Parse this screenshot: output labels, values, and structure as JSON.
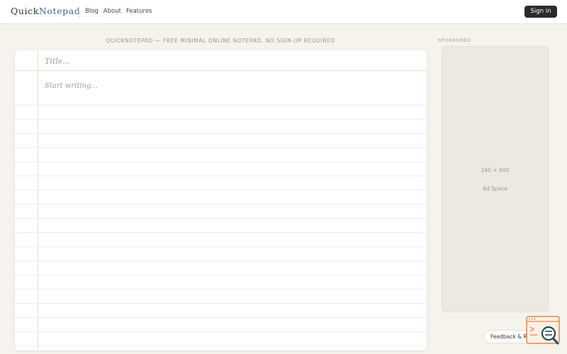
{
  "header": {
    "logo_part1": "Quick",
    "logo_part2": "Notepad",
    "nav": [
      {
        "label": "Blog"
      },
      {
        "label": "About"
      },
      {
        "label": "Features"
      }
    ],
    "signin_label": "Sign in"
  },
  "tagline": "QUICKNOTEPAD — FREE MINIMAL ONLINE NOTEPAD. NO SIGN-UP REQUIRED",
  "editor": {
    "title_placeholder": "Title...",
    "title_value": "",
    "body_placeholder": "Start writing...",
    "body_value": ""
  },
  "sidebar": {
    "sponsored_label": "SPONSORED",
    "ad_size": "240 × 600",
    "ad_label": "Ad Space"
  },
  "feedback": {
    "label": "Feedback & Requests"
  },
  "colors": {
    "page_bg": "#f6f3ec",
    "logo_accent": "#3d6a96",
    "signin_bg": "#2b2b2b",
    "feedback_icon": "#e8844a"
  }
}
